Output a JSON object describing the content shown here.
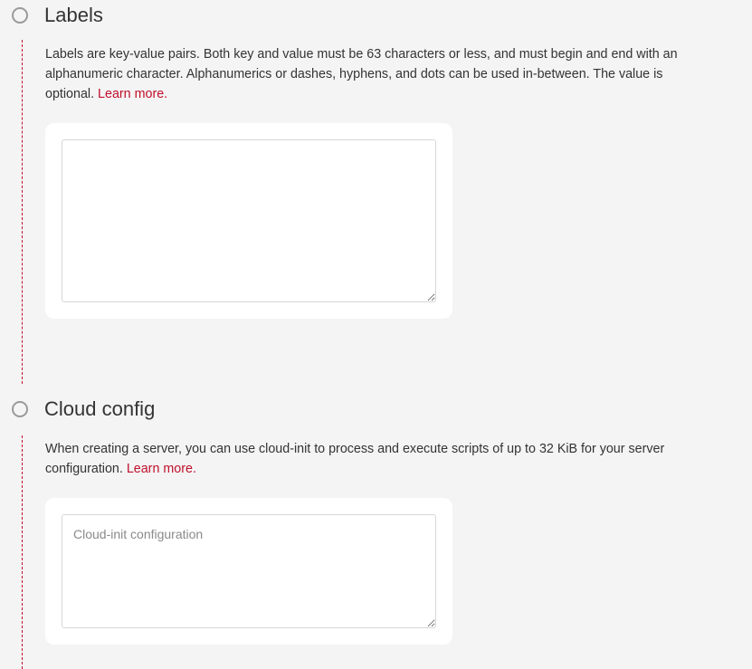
{
  "labels_step": {
    "title": "Labels",
    "description": "Labels are key-value pairs. Both key and value must be 63 characters or less, and must begin and end with an alphanumeric character. Alphanumerics or dashes, hyphens, and dots can be used in-between. The value is optional.",
    "learn_more": "Learn more.",
    "textarea_value": "",
    "textarea_placeholder": ""
  },
  "cloud_config_step": {
    "title": "Cloud config",
    "description": "When creating a server, you can use cloud-init to process and execute scripts of up to 32 KiB for your server configuration.",
    "learn_more": "Learn more.",
    "textarea_value": "",
    "textarea_placeholder": "Cloud-init configuration"
  },
  "colors": {
    "accent": "#c0102b",
    "background": "#f4f4f4",
    "card": "#ffffff"
  }
}
